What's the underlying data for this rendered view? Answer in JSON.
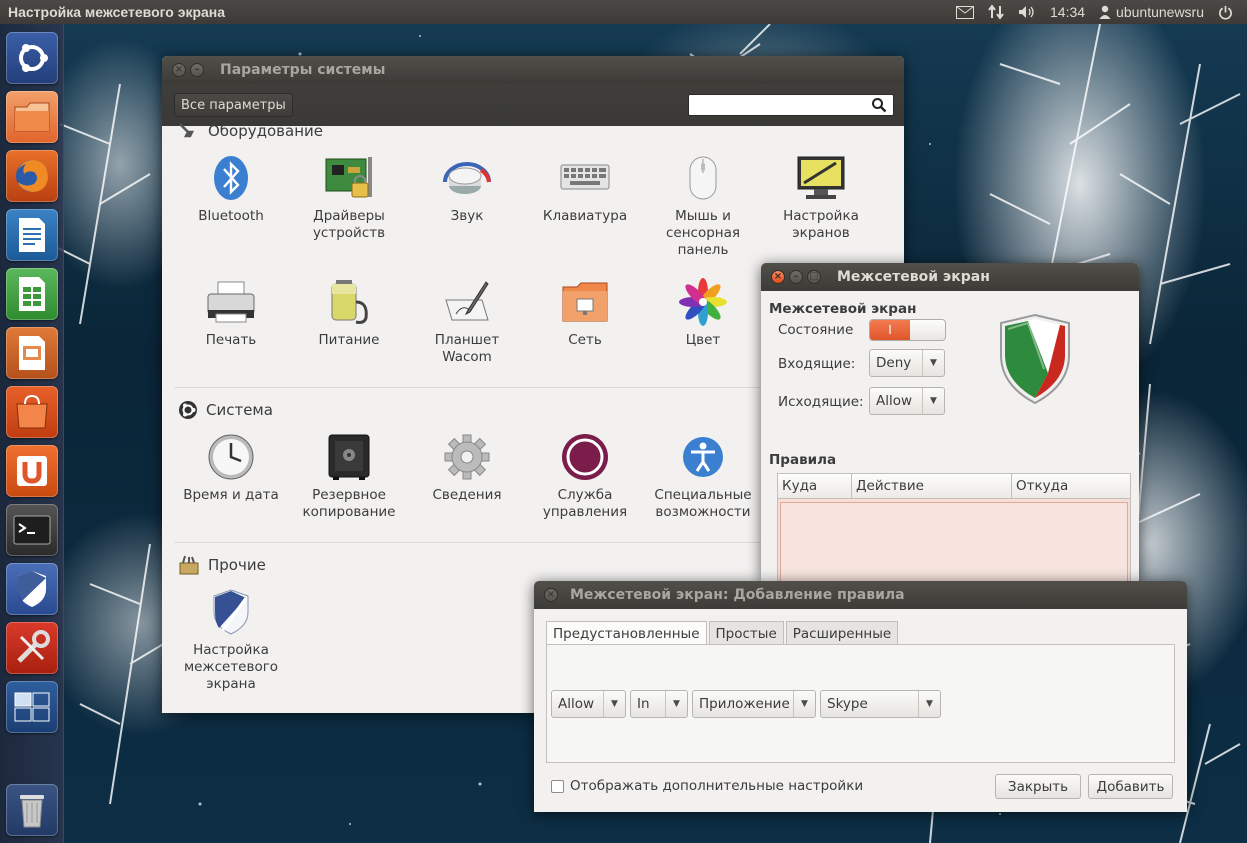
{
  "top_panel": {
    "app_title": "Настройка межсетевого экрана",
    "time": "14:34",
    "user": "ubuntunewsru"
  },
  "launcher": {
    "items": [
      {
        "name": "ubuntu-dash"
      },
      {
        "name": "files"
      },
      {
        "name": "firefox"
      },
      {
        "name": "writer"
      },
      {
        "name": "calc"
      },
      {
        "name": "impress"
      },
      {
        "name": "software-center"
      },
      {
        "name": "ubuntu-one"
      },
      {
        "name": "terminal"
      },
      {
        "name": "firewall-gufw"
      },
      {
        "name": "system-settings"
      },
      {
        "name": "workspace-switcher"
      },
      {
        "name": "trash"
      }
    ]
  },
  "settings_window": {
    "title": "Параметры системы",
    "all_settings_button": "Все параметры",
    "search_placeholder": "",
    "sections": {
      "hardware": {
        "title": "Оборудование",
        "items": [
          "Bluetooth",
          "Драйверы устройств",
          "Звук",
          "Клавиатура",
          "Мышь и сенсорная панель",
          "Настройка экранов",
          "Печать",
          "Питание",
          "Планшет Wacom",
          "Сеть",
          "Цвет"
        ]
      },
      "system": {
        "title": "Система",
        "items": [
          "Время и дата",
          "Резервное копирование",
          "Сведения",
          "Служба управления",
          "Специальные возможности"
        ]
      },
      "other": {
        "title": "Прочие",
        "items": [
          "Настройка межсетевого экрана"
        ]
      }
    }
  },
  "firewall_window": {
    "title": "Межсетевой экран",
    "heading": "Межсетевой экран",
    "status_label": "Состояние",
    "status_on": "I",
    "incoming_label": "Входящие:",
    "incoming_value": "Deny",
    "outgoing_label": "Исходящие:",
    "outgoing_value": "Allow",
    "rules_label": "Правила",
    "columns": [
      "Куда",
      "Действие",
      "Откуда"
    ]
  },
  "add_rule_dialog": {
    "title": "Межсетевой экран: Добавление правила",
    "tabs": [
      "Предустановленные",
      "Простые",
      "Расширенные"
    ],
    "action_value": "Allow",
    "direction_value": "In",
    "category_value": "Приложение",
    "app_value": "Skype",
    "show_advanced_label": "Отображать дополнительные настройки",
    "close_button": "Закрыть",
    "add_button": "Добавить"
  },
  "colors": {
    "accent_orange": "#e0552a",
    "panel_dark": "#3c3b37",
    "window_bg": "#f2f1f0",
    "rules_bg": "#f6ddd6"
  }
}
